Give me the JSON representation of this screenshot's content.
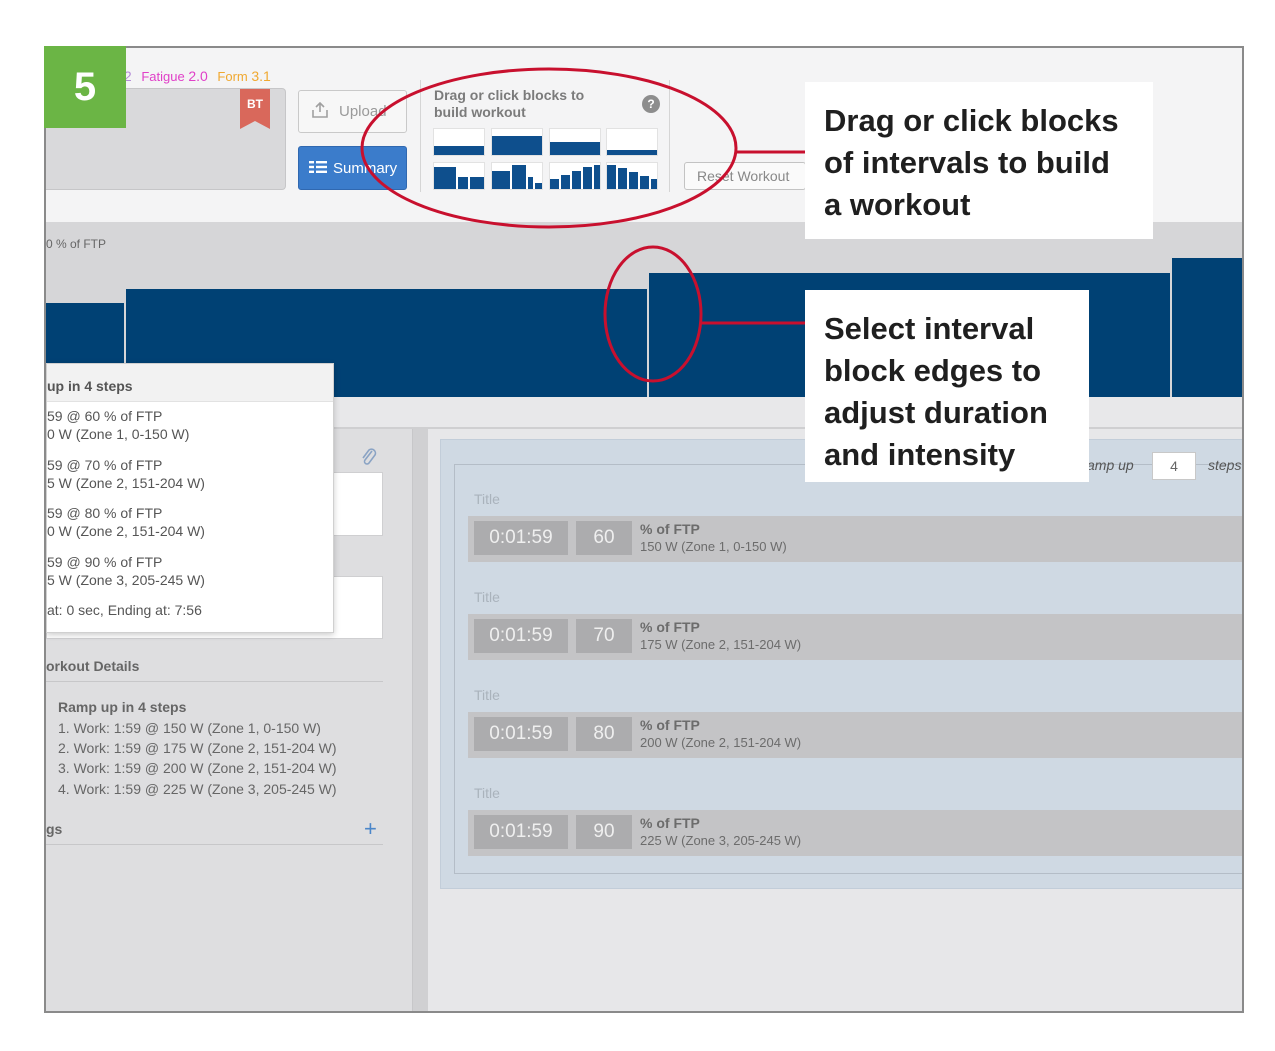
{
  "step_badge": "5",
  "metrics": {
    "fitness_value": ".2",
    "fatigue_label": "Fatigue",
    "fatigue_value": "2.0",
    "form_label": "Form",
    "form_value": "3.1"
  },
  "bt_badge": "BT",
  "toolbar": {
    "upload_label": "Upload",
    "summary_label": "Summary",
    "builder_hint": "Drag or click blocks to build workout",
    "help": "?",
    "reset_label": "Reset Workout"
  },
  "chart": {
    "axis_label": "0 % of FTP"
  },
  "popup": {
    "title": "up in 4 steps",
    "steps": [
      {
        "line1": "59 @ 60 % of FTP",
        "line2": "0 W (Zone 1, 0-150 W)"
      },
      {
        "line1": "59 @ 70 % of FTP",
        "line2": "5 W (Zone 2, 151-204 W)"
      },
      {
        "line1": "59 @ 80 % of FTP",
        "line2": "0 W (Zone 2, 151-204 W)"
      },
      {
        "line1": "59 @ 90 % of FTP",
        "line2": "5 W (Zone 3, 205-245 W)"
      }
    ],
    "footer": "at: 0 sec, Ending at: 7:56"
  },
  "workout_details": {
    "heading": "orkout Details",
    "title": "Ramp up in 4 steps",
    "items": [
      "1.  Work: 1:59 @ 150 W (Zone 1, 0-150 W)",
      "2.  Work: 1:59 @ 175 W (Zone 2, 151-204 W)",
      "3.  Work: 1:59 @ 200 W (Zone 2, 151-204 W)",
      "4.  Work: 1:59 @ 225 W (Zone 3, 205-245 W)"
    ]
  },
  "tags": {
    "heading": "gs",
    "add": "+"
  },
  "ramp": {
    "label": "amp up",
    "steps_value": "4",
    "steps_label": "steps"
  },
  "intervals": [
    {
      "title": "Title",
      "duration": "0:01:59",
      "percent": "60",
      "unit": "% of FTP",
      "zone": "150 W (Zone 1, 0-150 W)"
    },
    {
      "title": "Title",
      "duration": "0:01:59",
      "percent": "70",
      "unit": "% of FTP",
      "zone": "175 W (Zone 2, 151-204 W)"
    },
    {
      "title": "Title",
      "duration": "0:01:59",
      "percent": "80",
      "unit": "% of FTP",
      "zone": "200 W (Zone 2, 151-204 W)"
    },
    {
      "title": "Title",
      "duration": "0:01:59",
      "percent": "90",
      "unit": "% of FTP",
      "zone": "225 W (Zone 3, 205-245 W)"
    }
  ],
  "callouts": {
    "top": [
      "Drag or click blocks",
      "of intervals to build",
      "a workout"
    ],
    "bottom": [
      "Select interval",
      "block edges to",
      "adjust duration",
      "and intensity"
    ]
  },
  "colors": {
    "accent_blue": "#3b7ccb",
    "bar_navy": "#004174",
    "annotation_red": "#c8102e",
    "badge_green": "#6bb545",
    "fatigue_pink": "#e040c8",
    "form_orange": "#f0a830"
  },
  "icons": {
    "upload": "upload-icon",
    "summary": "list-icon",
    "help": "help-icon",
    "attach": "paperclip-icon",
    "add": "plus-icon"
  }
}
